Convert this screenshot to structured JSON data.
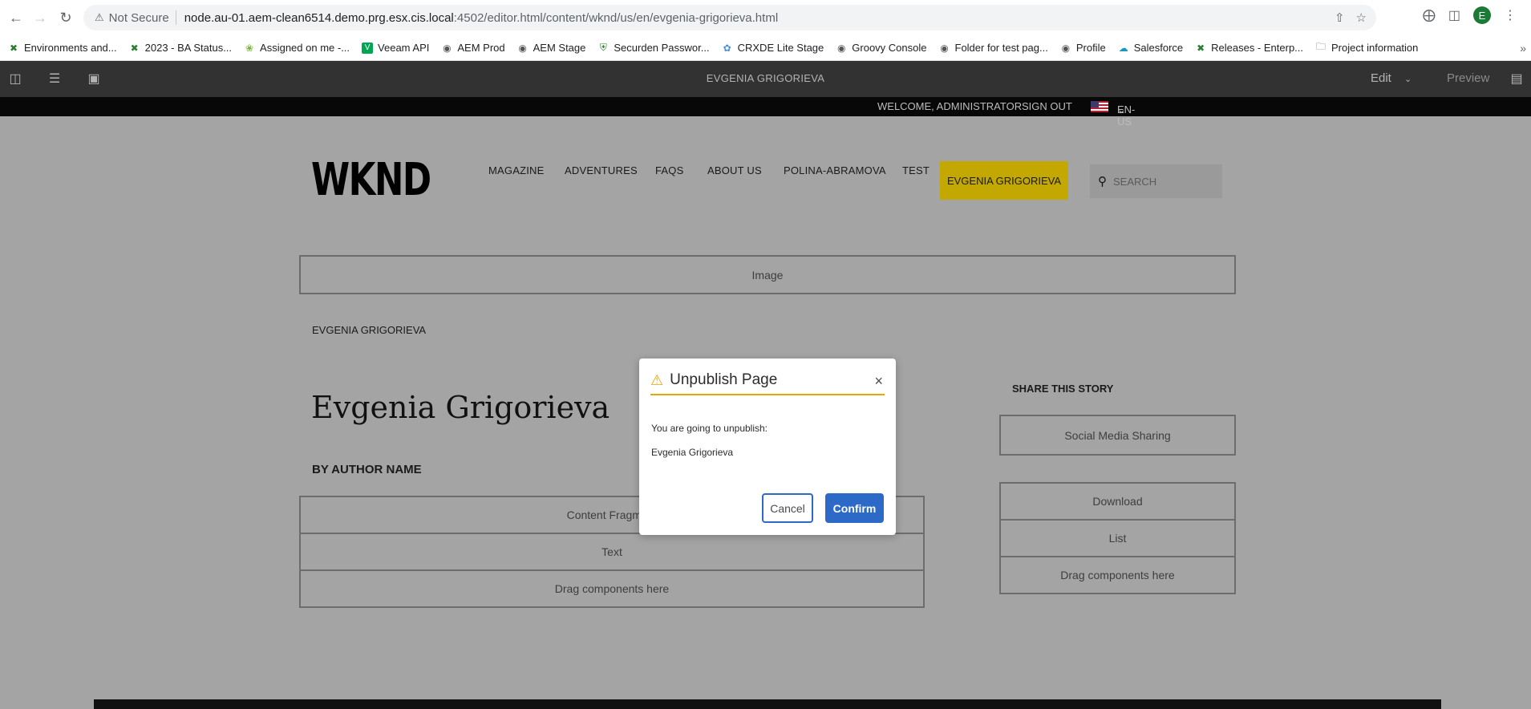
{
  "browser": {
    "security_label": "Not Secure",
    "url_host": "node.au-01.aem-clean6514.demo.prg.esx.cis.local",
    "url_path": ":4502/editor.html/content/wknd/us/en/evgenia-grigorieva.html",
    "profile_initial": "E",
    "bookmarks": [
      {
        "label": "Environments and...",
        "icon": "x-logo-icon",
        "color": "#2e7d32"
      },
      {
        "label": "2023 - BA Status...",
        "icon": "x-logo-icon",
        "color": "#2e7d32"
      },
      {
        "label": "Assigned on me -...",
        "icon": "badge-icon",
        "color": "#7cb342"
      },
      {
        "label": "Veeam API",
        "icon": "v-logo-icon",
        "color": "#00a651"
      },
      {
        "label": "AEM Prod",
        "icon": "globe-icon",
        "color": "#555555"
      },
      {
        "label": "AEM Stage",
        "icon": "globe-icon",
        "color": "#555555"
      },
      {
        "label": "Securden Passwor...",
        "icon": "shield-icon",
        "color": "#2e7d32"
      },
      {
        "label": "CRXDE Lite Stage",
        "icon": "crx-icon",
        "color": "#4a90d9"
      },
      {
        "label": "Groovy Console",
        "icon": "globe-icon",
        "color": "#555555"
      },
      {
        "label": "Folder for test pag...",
        "icon": "globe-icon",
        "color": "#555555"
      },
      {
        "label": "Profile",
        "icon": "globe-icon",
        "color": "#555555"
      },
      {
        "label": "Salesforce",
        "icon": "cloud-icon",
        "color": "#1798c1"
      },
      {
        "label": "Releases - Enterp...",
        "icon": "x-logo-icon",
        "color": "#2e7d32"
      },
      {
        "label": "Project information",
        "icon": "folder-icon",
        "color": "#5f6368"
      }
    ]
  },
  "aem": {
    "page_title": "EVGENIA GRIGORIEVA",
    "mode_label": "Edit",
    "preview_label": "Preview"
  },
  "site": {
    "welcome": "WELCOME, ADMINISTRATOR",
    "sign_out": "SIGN OUT",
    "language": "EN-US",
    "logo": "WKND",
    "nav": [
      "MAGAZINE",
      "ADVENTURES",
      "FAQS",
      "ABOUT US",
      "POLINA-ABRAMOVA",
      "TEST"
    ],
    "nav_active": "EVGENIA GRIGORIEVA",
    "search_placeholder": "SEARCH",
    "image_placeholder": "Image",
    "breadcrumb": "EVGENIA GRIGORIEVA",
    "article_title": "Evgenia Grigorieva",
    "byline": "BY AUTHOR NAME",
    "main_components": [
      "Content Fragment",
      "Text",
      "Drag components here"
    ],
    "share_heading": "SHARE THIS STORY",
    "social_component": "Social Media Sharing",
    "side_components": [
      "Download",
      "List",
      "Drag components here"
    ]
  },
  "dialog": {
    "title": "Unpublish Page",
    "message": "You are going to unpublish:",
    "item": "Evgenia Grigorieva",
    "cancel_label": "Cancel",
    "confirm_label": "Confirm",
    "accent_color": "#e6a700",
    "button_color": "#2d6ac8"
  }
}
